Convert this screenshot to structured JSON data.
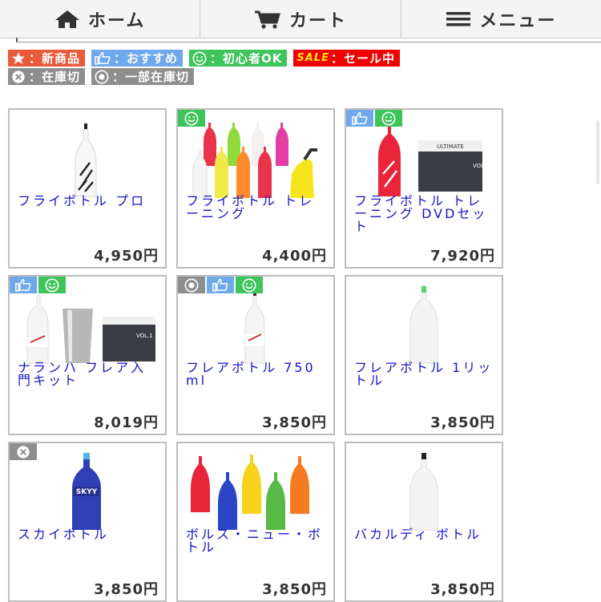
{
  "nav": {
    "home": "ホーム",
    "cart": "カート",
    "menu": "メニュー"
  },
  "legend": {
    "new": "：新商品",
    "recommend": "：おすすめ",
    "beginner": "：初心者OK",
    "sale_word": "SALE",
    "sale": "：セール中",
    "out_of_stock": "：在庫切",
    "partial_stock": "：一部在庫切"
  },
  "colors": {
    "new": "#e85a3a",
    "recommend": "#6ea9ec",
    "beginner": "#3dc45a",
    "sale": "#f00000",
    "stock": "#8e8e8e",
    "link": "#1515c8"
  },
  "products": [
    {
      "name": "フライボトル プロ",
      "price": "4,950円",
      "badges": []
    },
    {
      "name": "フライボトル トレーニング",
      "price": "4,400円",
      "badges": [
        "beginner"
      ]
    },
    {
      "name": "フライボトル トレーニング DVDセット",
      "price": "7,920円",
      "badges": [
        "recommend",
        "beginner"
      ]
    },
    {
      "name": "ナランハ フレア入門キット",
      "price": "8,019円",
      "badges": [
        "recommend",
        "beginner"
      ]
    },
    {
      "name": "フレアボトル 750ml",
      "price": "3,850円",
      "badges": [
        "partial",
        "recommend",
        "beginner"
      ]
    },
    {
      "name": "フレアボトル 1リットル",
      "price": "3,850円",
      "badges": []
    },
    {
      "name": "スカイボトル",
      "price": "3,850円",
      "badges": [
        "out"
      ]
    },
    {
      "name": "ボルス・ニュー・ボトル",
      "price": "3,850円",
      "badges": []
    },
    {
      "name": "バカルディ ボトル",
      "price": "3,850円",
      "badges": []
    }
  ]
}
